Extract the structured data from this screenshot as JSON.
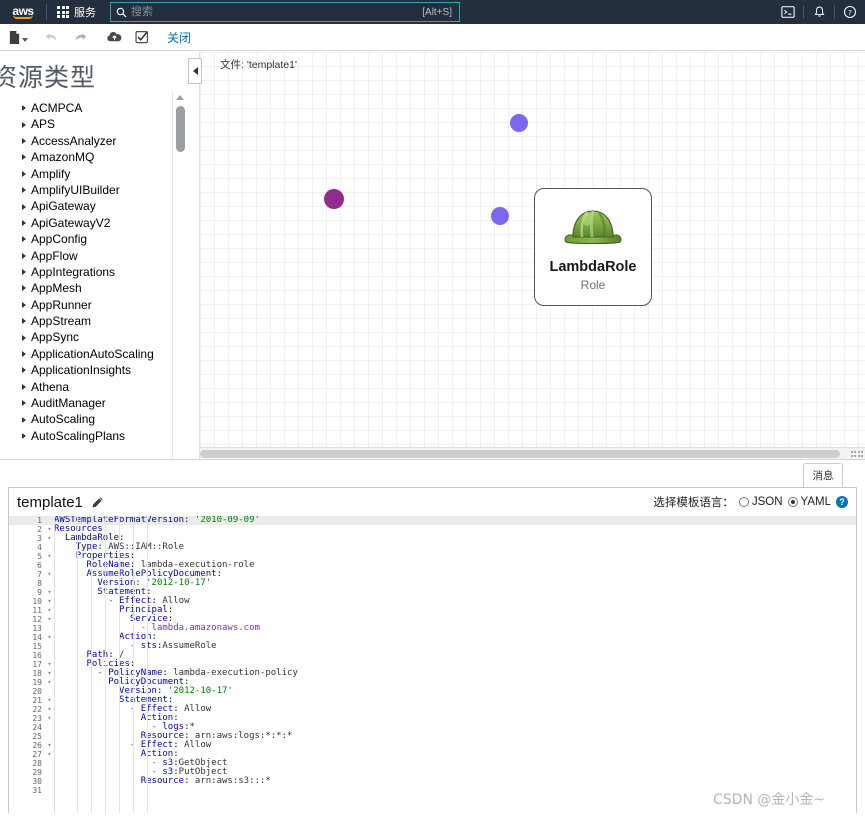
{
  "topnav": {
    "logo_text": "aws",
    "services_label": "服务",
    "search_placeholder": "搜索",
    "search_value": "",
    "search_shortcut": "[Alt+S]",
    "icons": [
      "cloudshell-icon",
      "notifications-bell-icon",
      "help-question-icon"
    ]
  },
  "toolbar": {
    "new_file_label": "new-file",
    "undo_label": "undo",
    "redo_label": "redo",
    "upload_label": "upload-to-s3",
    "validate_label": "validate-template",
    "close_label": "关闭"
  },
  "sidebar": {
    "title": "资源类型",
    "items": [
      {
        "label": "ACMPCA"
      },
      {
        "label": "APS"
      },
      {
        "label": "AccessAnalyzer"
      },
      {
        "label": "AmazonMQ"
      },
      {
        "label": "Amplify"
      },
      {
        "label": "AmplifyUIBuilder"
      },
      {
        "label": "ApiGateway"
      },
      {
        "label": "ApiGatewayV2"
      },
      {
        "label": "AppConfig"
      },
      {
        "label": "AppFlow"
      },
      {
        "label": "AppIntegrations"
      },
      {
        "label": "AppMesh"
      },
      {
        "label": "AppRunner"
      },
      {
        "label": "AppStream"
      },
      {
        "label": "AppSync"
      },
      {
        "label": "ApplicationAutoScaling"
      },
      {
        "label": "ApplicationInsights"
      },
      {
        "label": "Athena"
      },
      {
        "label": "AuditManager"
      },
      {
        "label": "AutoScaling"
      },
      {
        "label": "AutoScalingPlans"
      }
    ]
  },
  "canvas": {
    "file_label": "文件: 'template1'",
    "collapse_label": "collapse-panel",
    "node": {
      "title": "LambdaRole",
      "subtitle": "Role",
      "icon": "iam-role-hardhat-icon",
      "ports": [
        {
          "name": "port-top-right",
          "color": "#7b68ee"
        },
        {
          "name": "port-bottom-right",
          "color": "#7b68ee"
        },
        {
          "name": "port-left",
          "color": "#922b8e"
        }
      ]
    }
  },
  "editor": {
    "messages_tab": "消息",
    "template_name": "template1",
    "edit_icon": "pencil-edit-icon",
    "lang_label": "选择模板语言：",
    "lang_options": [
      {
        "label": "JSON",
        "selected": false
      },
      {
        "label": "YAML",
        "selected": true
      }
    ],
    "help_icon_label": "?",
    "code_lines": [
      {
        "n": 1,
        "fold": false,
        "text": "AWSTemplateFormatVersion: '2010-09-09'"
      },
      {
        "n": 2,
        "fold": true,
        "text": "Resources:"
      },
      {
        "n": 3,
        "fold": true,
        "text": "  LambdaRole:"
      },
      {
        "n": 4,
        "fold": false,
        "text": "    Type: AWS::IAM::Role"
      },
      {
        "n": 5,
        "fold": true,
        "text": "    Properties:"
      },
      {
        "n": 6,
        "fold": false,
        "text": "      RoleName: lambda-execution-role"
      },
      {
        "n": 7,
        "fold": true,
        "text": "      AssumeRolePolicyDocument:"
      },
      {
        "n": 8,
        "fold": false,
        "text": "        Version: '2012-10-17'"
      },
      {
        "n": 9,
        "fold": true,
        "text": "        Statement:"
      },
      {
        "n": 10,
        "fold": true,
        "text": "          - Effect: Allow"
      },
      {
        "n": 11,
        "fold": true,
        "text": "            Principal:"
      },
      {
        "n": 12,
        "fold": true,
        "text": "              Service:"
      },
      {
        "n": 13,
        "fold": false,
        "text": "                - lambda.amazonaws.com"
      },
      {
        "n": 14,
        "fold": true,
        "text": "            Action:"
      },
      {
        "n": 15,
        "fold": false,
        "text": "              - sts:AssumeRole"
      },
      {
        "n": 16,
        "fold": false,
        "text": "      Path: /"
      },
      {
        "n": 17,
        "fold": true,
        "text": "      Policies:"
      },
      {
        "n": 18,
        "fold": true,
        "text": "        - PolicyName: lambda-execution-policy"
      },
      {
        "n": 19,
        "fold": true,
        "text": "          PolicyDocument:"
      },
      {
        "n": 20,
        "fold": false,
        "text": "            Version: '2012-10-17'"
      },
      {
        "n": 21,
        "fold": true,
        "text": "            Statement:"
      },
      {
        "n": 22,
        "fold": true,
        "text": "              - Effect: Allow"
      },
      {
        "n": 23,
        "fold": true,
        "text": "                Action:"
      },
      {
        "n": 24,
        "fold": false,
        "text": "                  - logs:*"
      },
      {
        "n": 25,
        "fold": false,
        "text": "                Resource: arn:aws:logs:*:*:*"
      },
      {
        "n": 26,
        "fold": true,
        "text": "              - Effect: Allow"
      },
      {
        "n": 27,
        "fold": true,
        "text": "                Action:"
      },
      {
        "n": 28,
        "fold": false,
        "text": "                  - s3:GetObject"
      },
      {
        "n": 29,
        "fold": false,
        "text": "                  - s3:PutObject"
      },
      {
        "n": 30,
        "fold": false,
        "text": "                Resource: arn:aws:s3:::*"
      },
      {
        "n": 31,
        "fold": false,
        "text": ""
      }
    ]
  },
  "watermark": "CSDN @金小金~",
  "colors": {
    "nav_bg": "#232f3e",
    "accent_orange": "#ff9900",
    "link_blue": "#0073bb",
    "search_border": "#2ea8b0",
    "port_purple": "#7b68ee",
    "port_magenta": "#922b8e"
  }
}
